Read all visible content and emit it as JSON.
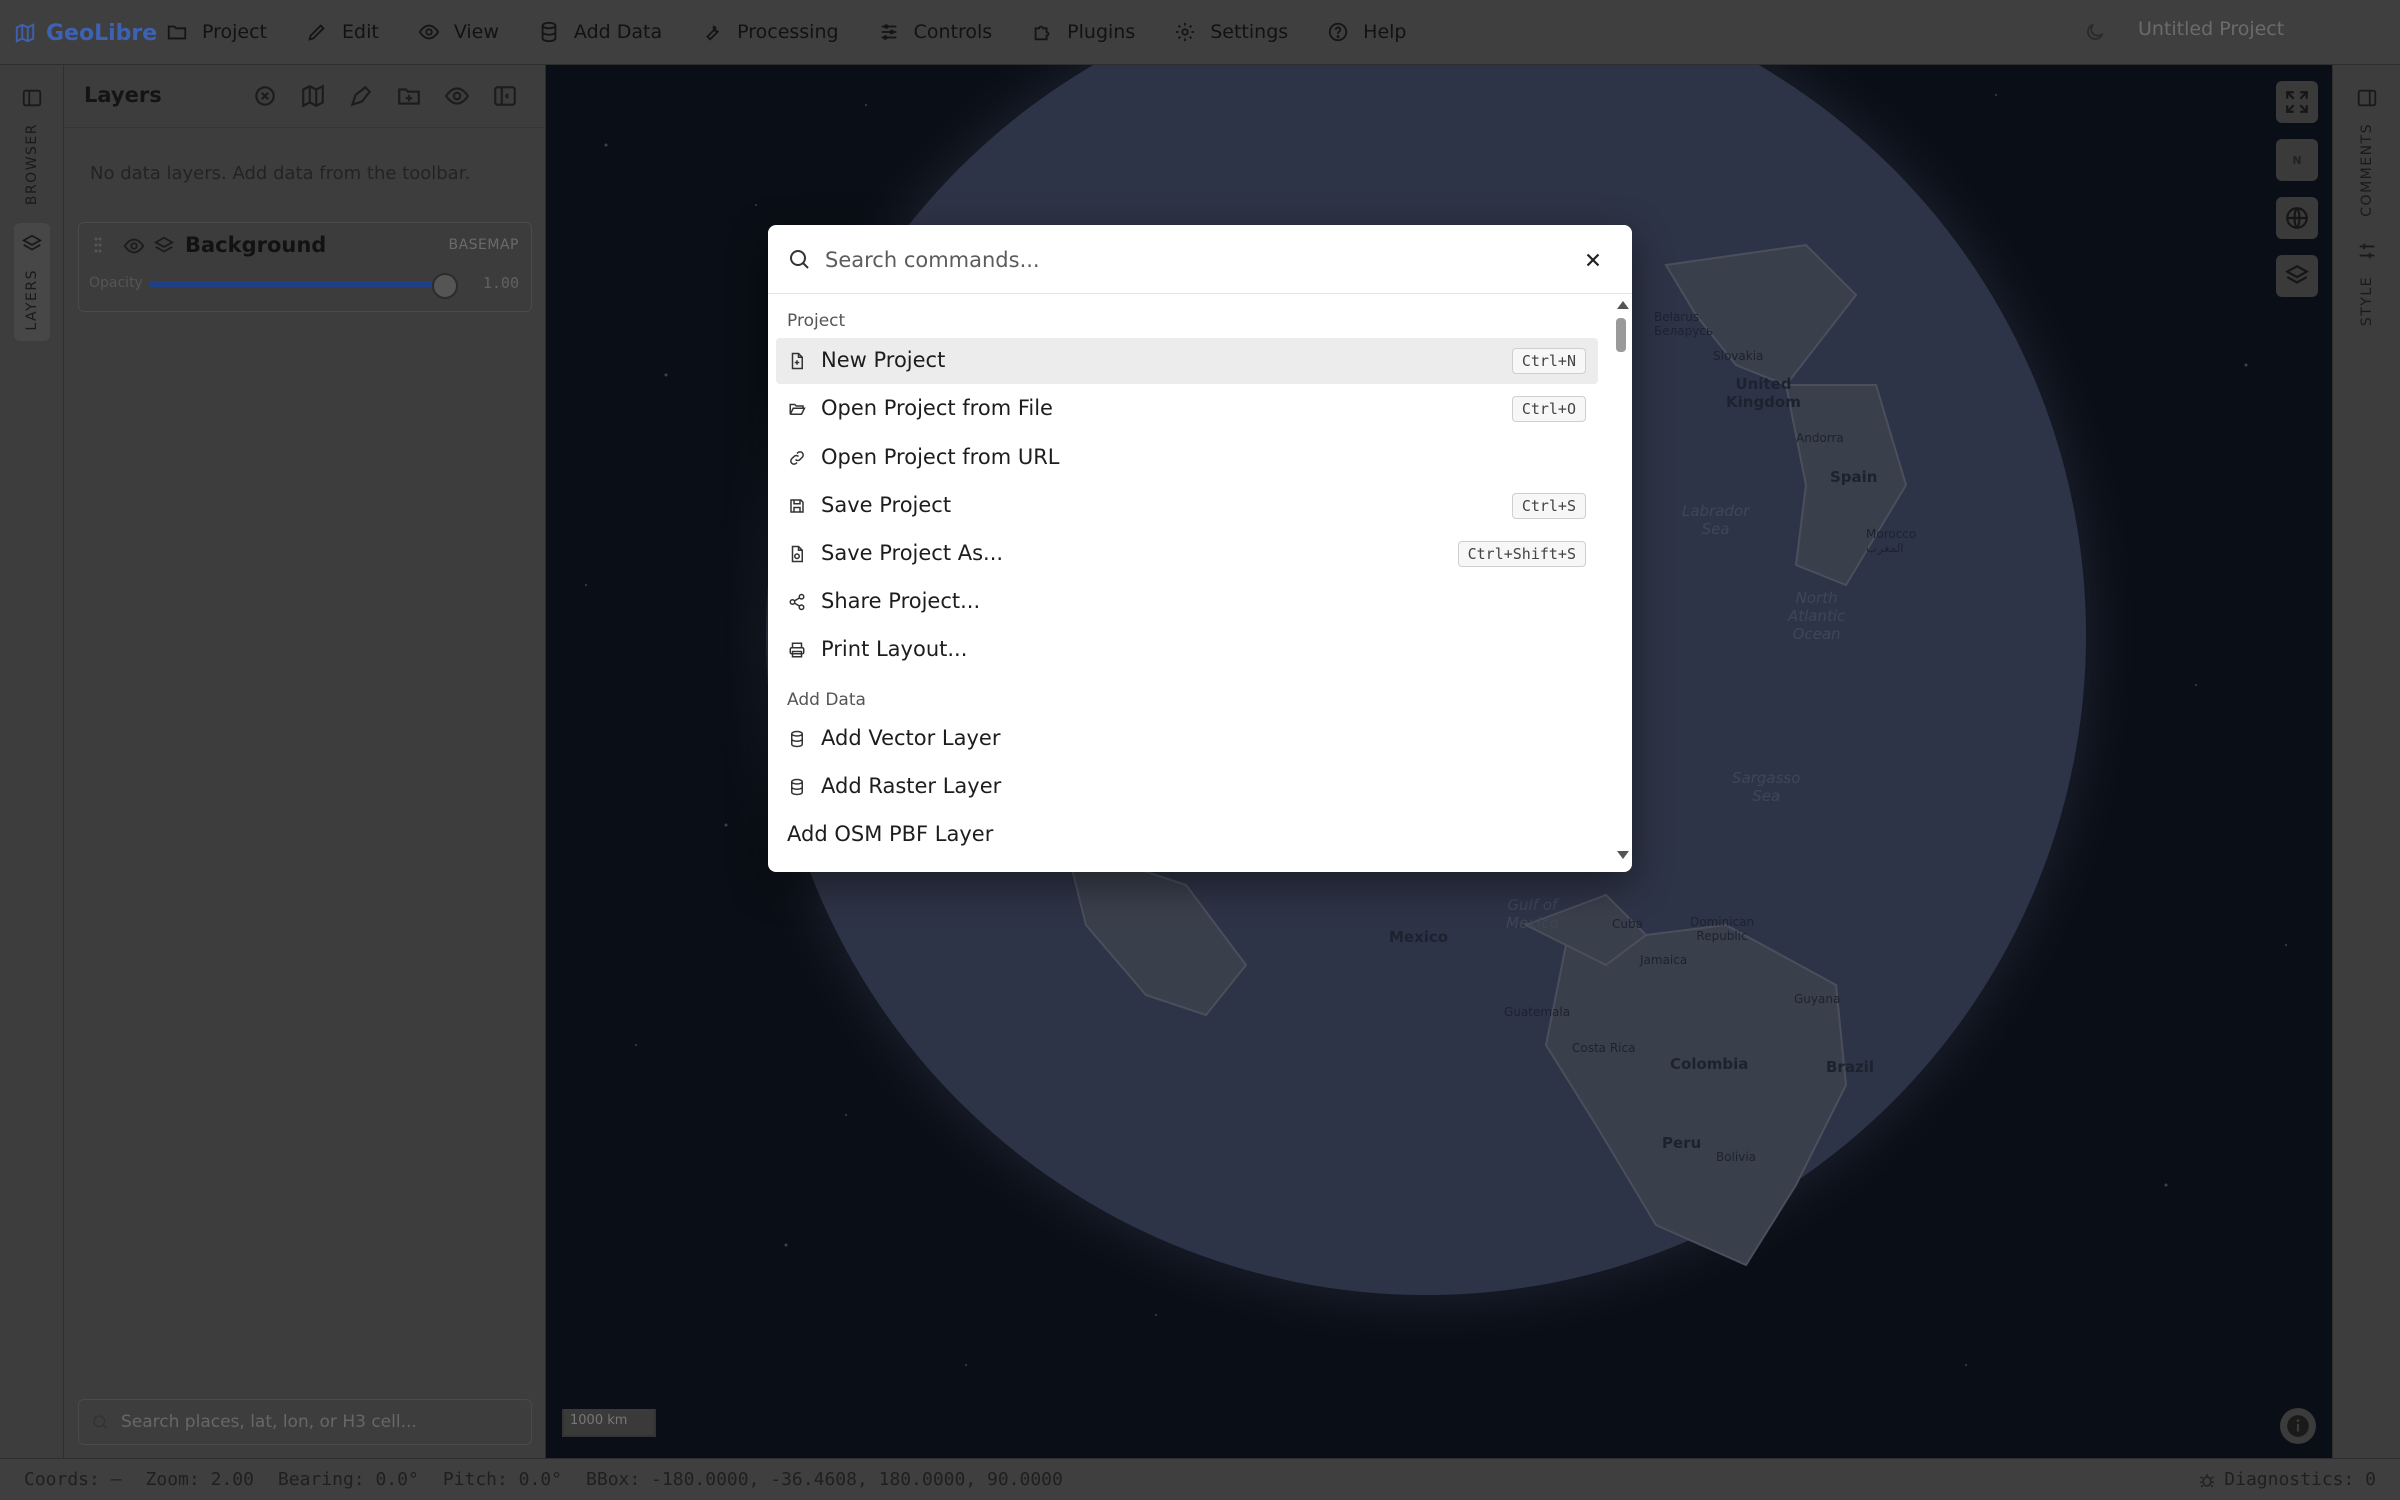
{
  "app": {
    "name": "GeoLibre",
    "project_title": "Untitled Project"
  },
  "menu": [
    {
      "id": "project",
      "label": "Project",
      "icon": "folder-icon"
    },
    {
      "id": "edit",
      "label": "Edit",
      "icon": "pencil-icon"
    },
    {
      "id": "view",
      "label": "View",
      "icon": "eye-icon"
    },
    {
      "id": "add-data",
      "label": "Add Data",
      "icon": "database-icon"
    },
    {
      "id": "processing",
      "label": "Processing",
      "icon": "wrench-icon"
    },
    {
      "id": "controls",
      "label": "Controls",
      "icon": "sliders-icon"
    },
    {
      "id": "plugins",
      "label": "Plugins",
      "icon": "puzzle-icon"
    },
    {
      "id": "settings",
      "label": "Settings",
      "icon": "gear-icon"
    },
    {
      "id": "help",
      "label": "Help",
      "icon": "help-circle-icon"
    }
  ],
  "left_rail": {
    "browser_label": "BROWSER",
    "layers_label": "LAYERS"
  },
  "right_rail": {
    "comments_label": "COMMENTS",
    "style_label": "STYLE"
  },
  "layers_panel": {
    "title": "Layers",
    "empty_message": "No data layers. Add data from the toolbar.",
    "layer": {
      "name": "Background",
      "type": "BASEMAP",
      "opacity_label": "Opacity",
      "opacity_value": "1.00",
      "opacity": 1.0
    },
    "search_placeholder": "Search places, lat, lon, or H3 cell..."
  },
  "map": {
    "scale_label": "1000 km",
    "compass_label": "N",
    "labels": {
      "belarus": "Belarus\nБеларусь",
      "slovakia": "Slovakia",
      "uk": "United\nKingdom",
      "andorra": "Andorra",
      "spain": "Spain",
      "labrador": "Labrador\nSea",
      "morocco": "Morocco\nالمغرب",
      "north_atlantic": "North\nAtlantic\nOcean",
      "sargasso": "Sargasso\nSea",
      "gulf_mexico": "Gulf of\nMexico",
      "mexico": "Mexico",
      "cuba": "Cuba",
      "dominican": "Dominican\nRepublic",
      "jamaica": "Jamaica",
      "guatemala": "Guatemala",
      "costa_rica": "Costa Rica",
      "guyana": "Guyana",
      "colombia": "Colombia",
      "brazil": "Brazil",
      "peru": "Peru",
      "bolivia": "Bolivia"
    }
  },
  "status": {
    "coords": "Coords: —",
    "zoom": "Zoom: 2.00",
    "bearing": "Bearing: 0.0°",
    "pitch": "Pitch: 0.0°",
    "bbox": "BBox: -180.0000, -36.4608, 180.0000, 90.0000",
    "diagnostics": "Diagnostics: 0"
  },
  "palette": {
    "search_placeholder": "Search commands...",
    "groups": [
      {
        "heading": "Project",
        "items": [
          {
            "label": "New Project",
            "shortcut": "Ctrl+N",
            "icon": "file-plus-icon",
            "active": true
          },
          {
            "label": "Open Project from File",
            "shortcut": "Ctrl+O",
            "icon": "folder-open-icon"
          },
          {
            "label": "Open Project from URL",
            "shortcut": "",
            "icon": "link-icon"
          },
          {
            "label": "Save Project",
            "shortcut": "Ctrl+S",
            "icon": "save-icon"
          },
          {
            "label": "Save Project As...",
            "shortcut": "Ctrl+Shift+S",
            "icon": "file-save-icon"
          },
          {
            "label": "Share Project...",
            "shortcut": "",
            "icon": "share-icon"
          },
          {
            "label": "Print Layout...",
            "shortcut": "",
            "icon": "printer-icon"
          }
        ]
      },
      {
        "heading": "Add Data",
        "items": [
          {
            "label": "Add Vector Layer",
            "shortcut": "",
            "icon": "database-icon"
          },
          {
            "label": "Add Raster Layer",
            "shortcut": "",
            "icon": "database-icon"
          },
          {
            "label": "Add OSM PBF Layer",
            "shortcut": "",
            "icon": ""
          }
        ]
      }
    ]
  }
}
